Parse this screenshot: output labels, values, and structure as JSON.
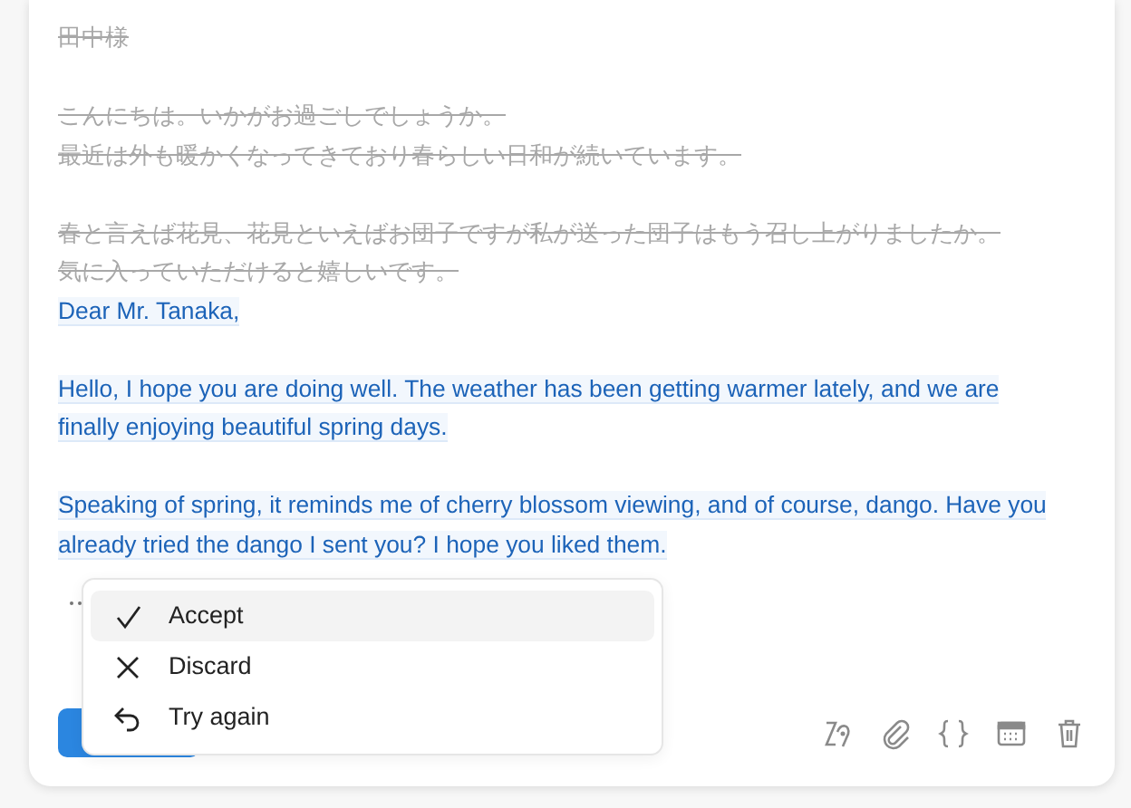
{
  "diff": [
    {
      "kind": "deleted",
      "lines": [
        "田中様"
      ]
    },
    {
      "kind": "deleted",
      "lines": [
        "こんにちは。いかがお過ごしでしょうか。",
        "最近は外も暖かくなってきており春らしい日和が続いています。"
      ]
    },
    {
      "kind": "deleted",
      "lines": [
        "春と言えば花見、花見といえばお団子ですが私が送った団子はもう召し上がりましたか。",
        "気に入っていただけると嬉しいです。"
      ]
    },
    {
      "kind": "inserted",
      "lines": [
        "Dear Mr. Tanaka,"
      ]
    },
    {
      "kind": "inserted",
      "lines": [
        "Hello, I hope you are doing well. The weather has been getting warmer lately, and we are",
        "finally enjoying beautiful spring days."
      ]
    },
    {
      "kind": "inserted",
      "lines": [
        "Speaking of spring, it reminds me of cherry blossom viewing, and of course, dango. Have you",
        "already tried the dango I sent you? I hope you liked them."
      ]
    }
  ],
  "menu": [
    {
      "kind": "check",
      "label": "Accept",
      "selected": true
    },
    {
      "kind": "cross",
      "label": "Discard",
      "selected": false
    },
    {
      "kind": "undo",
      "label": "Try again",
      "selected": false
    }
  ]
}
